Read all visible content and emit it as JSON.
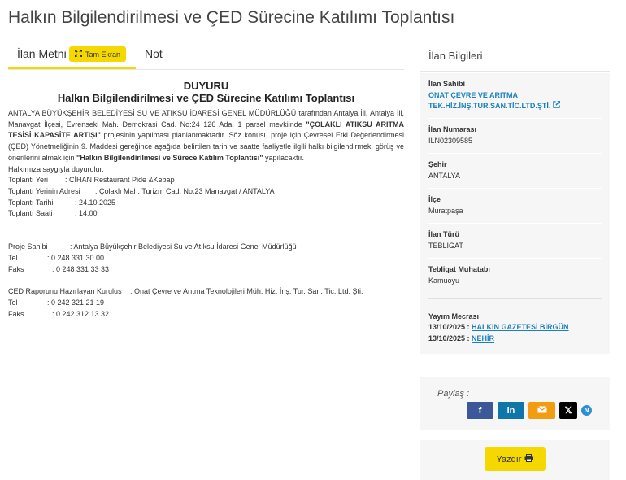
{
  "page": {
    "title": "Halkın Bilgilendirilmesi ve ÇED Sürecine Katılımı Toplantısı"
  },
  "tabs": {
    "ilan_metni": "İlan Metni |",
    "tam_ekran": "Tam Ekran",
    "not": "Not"
  },
  "notice": {
    "heading": "DUYURU",
    "subheading": "Halkın Bilgilendirilmesi ve ÇED Sürecine Katılımı Toplantısı",
    "p1_a": "ANTALYA BÜYÜKŞEHİR BELEDİYESİ SU VE ATIKSU İDARESİ GENEL MÜDÜRLÜĞÜ tarafından Antalya İli, Antalya İli, Manavgat İlçesi, Evrenseki Mah. Demokrasi Cad. No:24 126 Ada, 1 parsel mevkiinde ",
    "p1_b": "\"ÇOLAKLI ATIKSU ARITMA TESİSİ KAPASİTE ARTIŞI\"",
    "p1_c": " projesinin yapılması planlanmaktadır. Söz konusu proje için Çevresel Etki Değerlendirmesi (ÇED) Yönetmeliğinin 9. Maddesi gereğince aşağıda belirtilen tarih ve saatte faaliyetle ilgili halkı bilgilendirmek, görüş ve önerilerini almak için ",
    "p1_d": "\"Halkın Bilgilendirilmesi ve Sürece Katılım Toplantısı\"",
    "p1_e": " yapılacaktır.",
    "p2": "Halkımıza saygıyla duyurulur.",
    "meeting": [
      {
        "k": "Toplantı Yeri",
        "v": ": CİHAN Restaurant Pide &Kebap"
      },
      {
        "k": "Toplantı Yerinin Adresi",
        "v": ": Çolaklı Mah. Turizm Cad.  No:23  Manavgat / ANTALYA"
      },
      {
        "k": "Toplantı Tarihi",
        "v": ": 24.10.2025"
      },
      {
        "k": "Toplantı Saati",
        "v": ": 14:00"
      }
    ],
    "owner": [
      {
        "k": "Proje Sahibi",
        "v": ": Antalya Büyükşehir Belediyesi  Su ve Atıksu İdaresi Genel Müdürlüğü"
      },
      {
        "k": "Tel",
        "v": ": 0 248 331 30 00"
      },
      {
        "k": "Faks",
        "v": ": 0 248 331 33 33"
      }
    ],
    "consultant": [
      {
        "k": "ÇED Raporunu Hazırlayan Kuruluş",
        "v": ": Onat Çevre ve Arıtma Teknolojileri Müh. Hiz. İnş. Tur. San. Tic. Ltd. Şti."
      },
      {
        "k": "Tel",
        "v": ": 0 242 321 21 19"
      },
      {
        "k": "Faks",
        "v": ": 0 242 312 13 32"
      }
    ]
  },
  "sidebar": {
    "title": "İlan Bilgileri",
    "owner_label": "İlan Sahibi",
    "owner_line1": "ONAT ÇEVRE VE ARITMA",
    "owner_line2": "TEK.HİZ.İNŞ.TUR.SAN.TİC.LTD.ŞTİ.",
    "number_label": "İlan Numarası",
    "number": "ILN02309585",
    "city_label": "Şehir",
    "city": "ANTALYA",
    "district_label": "İlçe",
    "district": "Muratpaşa",
    "type_label": "İlan Türü",
    "type": "TEBLİGAT",
    "addressee_label": "Tebligat Muhatabı",
    "addressee": "Kamuoyu",
    "pub_label": "Yayım Mecrası",
    "pubs": [
      {
        "date": "13/10/2025 : ",
        "names": "HALKIN GAZETESİ BİRGÜN"
      },
      {
        "date": "13/10/2025 : ",
        "names": "NEHİR"
      }
    ]
  },
  "share": {
    "label": "Paylaş :",
    "facebook": "f",
    "linkedin": "in",
    "x": "𝕏",
    "nsosyal": "N",
    "colors": {
      "facebook": "#3b5998",
      "linkedin": "#0e76a8",
      "email": "#f39c12",
      "x": "#000000",
      "nsosyal": "#2b8fd6"
    }
  },
  "print": {
    "label": "Yazdır"
  },
  "accent": "#f4d800"
}
